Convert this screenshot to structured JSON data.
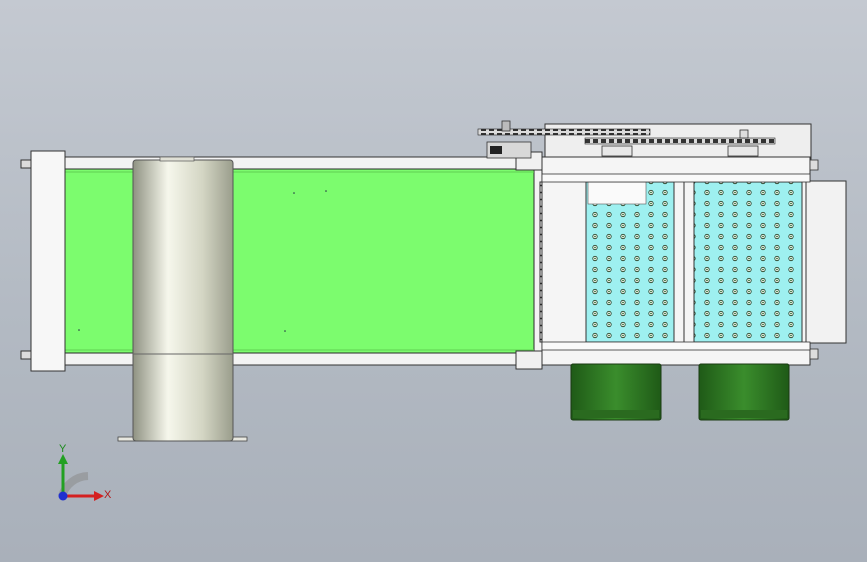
{
  "viewport": {
    "background_top": "#c4c9d1",
    "background_bottom": "#a9b0ba"
  },
  "model": {
    "belt_color": "#7cfc6e",
    "roller_color": "#d9dcc8",
    "frame_color": "#f2f2f2",
    "mesh_color": "#9ef0f0",
    "bin_color": "#2f7d23"
  },
  "triad": {
    "x_label": "X",
    "y_label": "Y",
    "x_color": "#d42020",
    "y_color": "#22a022",
    "z_color": "#2030d0"
  }
}
